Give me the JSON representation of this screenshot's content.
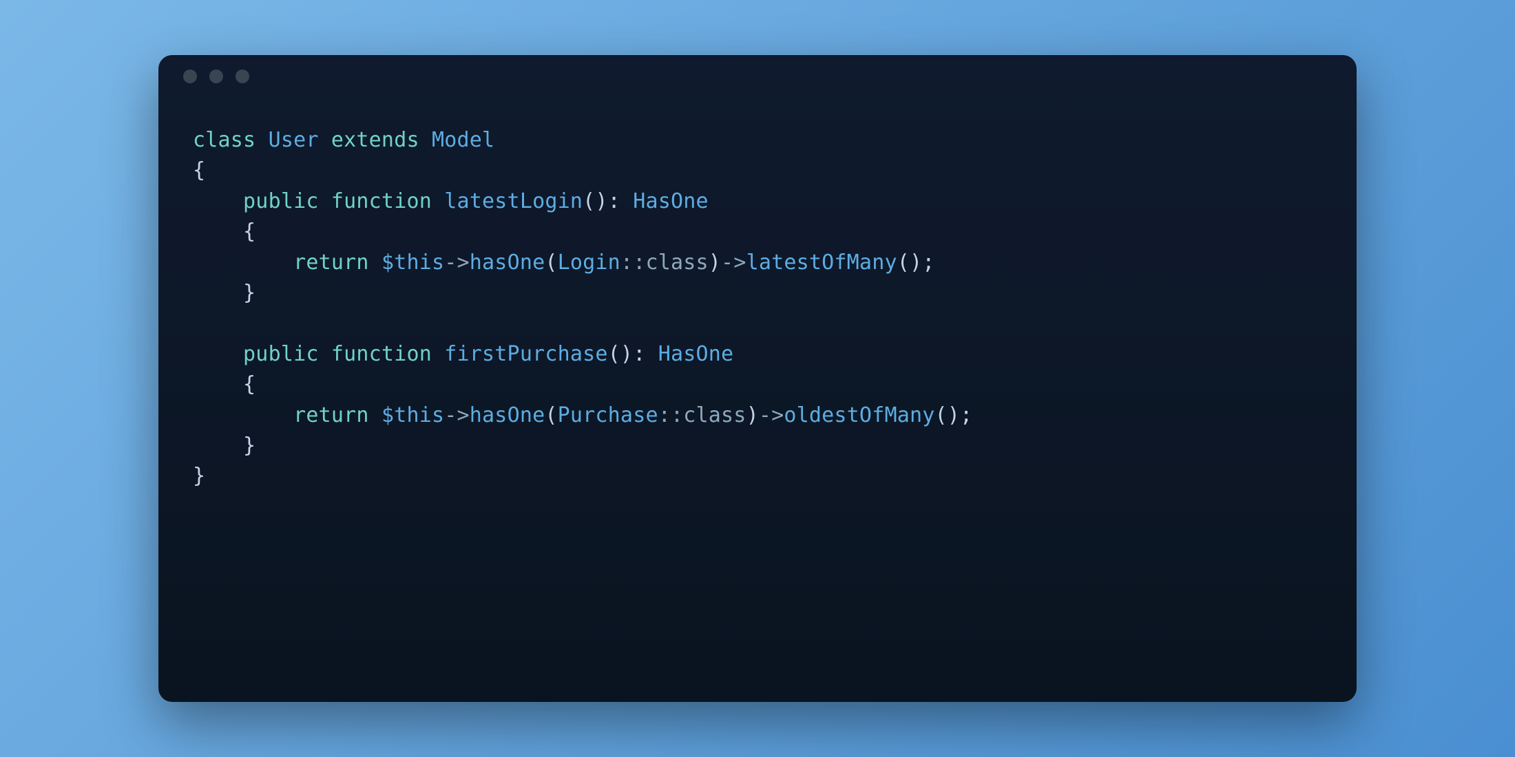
{
  "code": {
    "line1": {
      "kw1": "class",
      "cls1": "User",
      "kw2": "extends",
      "cls2": "Model"
    },
    "line2": "{",
    "line3": {
      "kw1": "public",
      "kw2": "function",
      "fn": "latestLogin",
      "paren": "()",
      "colon": ":",
      "type": "HasOne"
    },
    "line4": "    {",
    "line5": {
      "kw": "return",
      "var": "$this",
      "arrow1": "->",
      "m1": "hasOne",
      "p1": "(",
      "cls": "Login",
      "dcolon": "::",
      "classkw": "class",
      "p2": ")",
      "arrow2": "->",
      "m2": "latestOfMany",
      "p3": "()",
      "semi": ";"
    },
    "line6": "    }",
    "line7": "",
    "line8": {
      "kw1": "public",
      "kw2": "function",
      "fn": "firstPurchase",
      "paren": "()",
      "colon": ":",
      "type": "HasOne"
    },
    "line9": "    {",
    "line10": {
      "kw": "return",
      "var": "$this",
      "arrow1": "->",
      "m1": "hasOne",
      "p1": "(",
      "cls": "Purchase",
      "dcolon": "::",
      "classkw": "class",
      "p2": ")",
      "arrow2": "->",
      "m2": "oldestOfMany",
      "p3": "()",
      "semi": ";"
    },
    "line11": "    }",
    "line12": "}"
  }
}
